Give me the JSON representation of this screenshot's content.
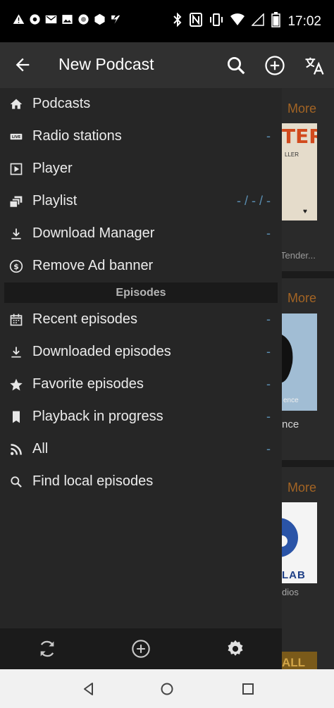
{
  "status": {
    "time": "17:02"
  },
  "toolbar": {
    "title": "New Podcast"
  },
  "drawer": {
    "items": [
      {
        "label": "Podcasts",
        "count": ""
      },
      {
        "label": "Radio stations",
        "count": "-"
      },
      {
        "label": "Player",
        "count": ""
      },
      {
        "label": "Playlist",
        "count": "- / - / -"
      },
      {
        "label": "Download Manager",
        "count": "-"
      },
      {
        "label": "Remove Ad banner",
        "count": ""
      }
    ],
    "section_header": "Episodes",
    "episode_items": [
      {
        "label": "Recent episodes",
        "count": "-"
      },
      {
        "label": "Downloaded episodes",
        "count": "-"
      },
      {
        "label": "Favorite episodes",
        "count": "-"
      },
      {
        "label": "Playback in progress",
        "count": "-"
      },
      {
        "label": "All",
        "count": "-"
      },
      {
        "label": "Find local episodes",
        "count": ""
      }
    ]
  },
  "background": {
    "more_label": "More",
    "card1_title": "TER",
    "card1_sub": "LLER",
    "card1_caption": "Tender...",
    "card2_caption": "nce",
    "card2_small": "ence",
    "card3_title": "LAB",
    "card3_caption": "dios",
    "card3_button": "ALL"
  },
  "colors": {
    "accent": "#a36424",
    "count": "#5b8fb3",
    "drawer": "#262626",
    "toolbar": "#303030"
  }
}
